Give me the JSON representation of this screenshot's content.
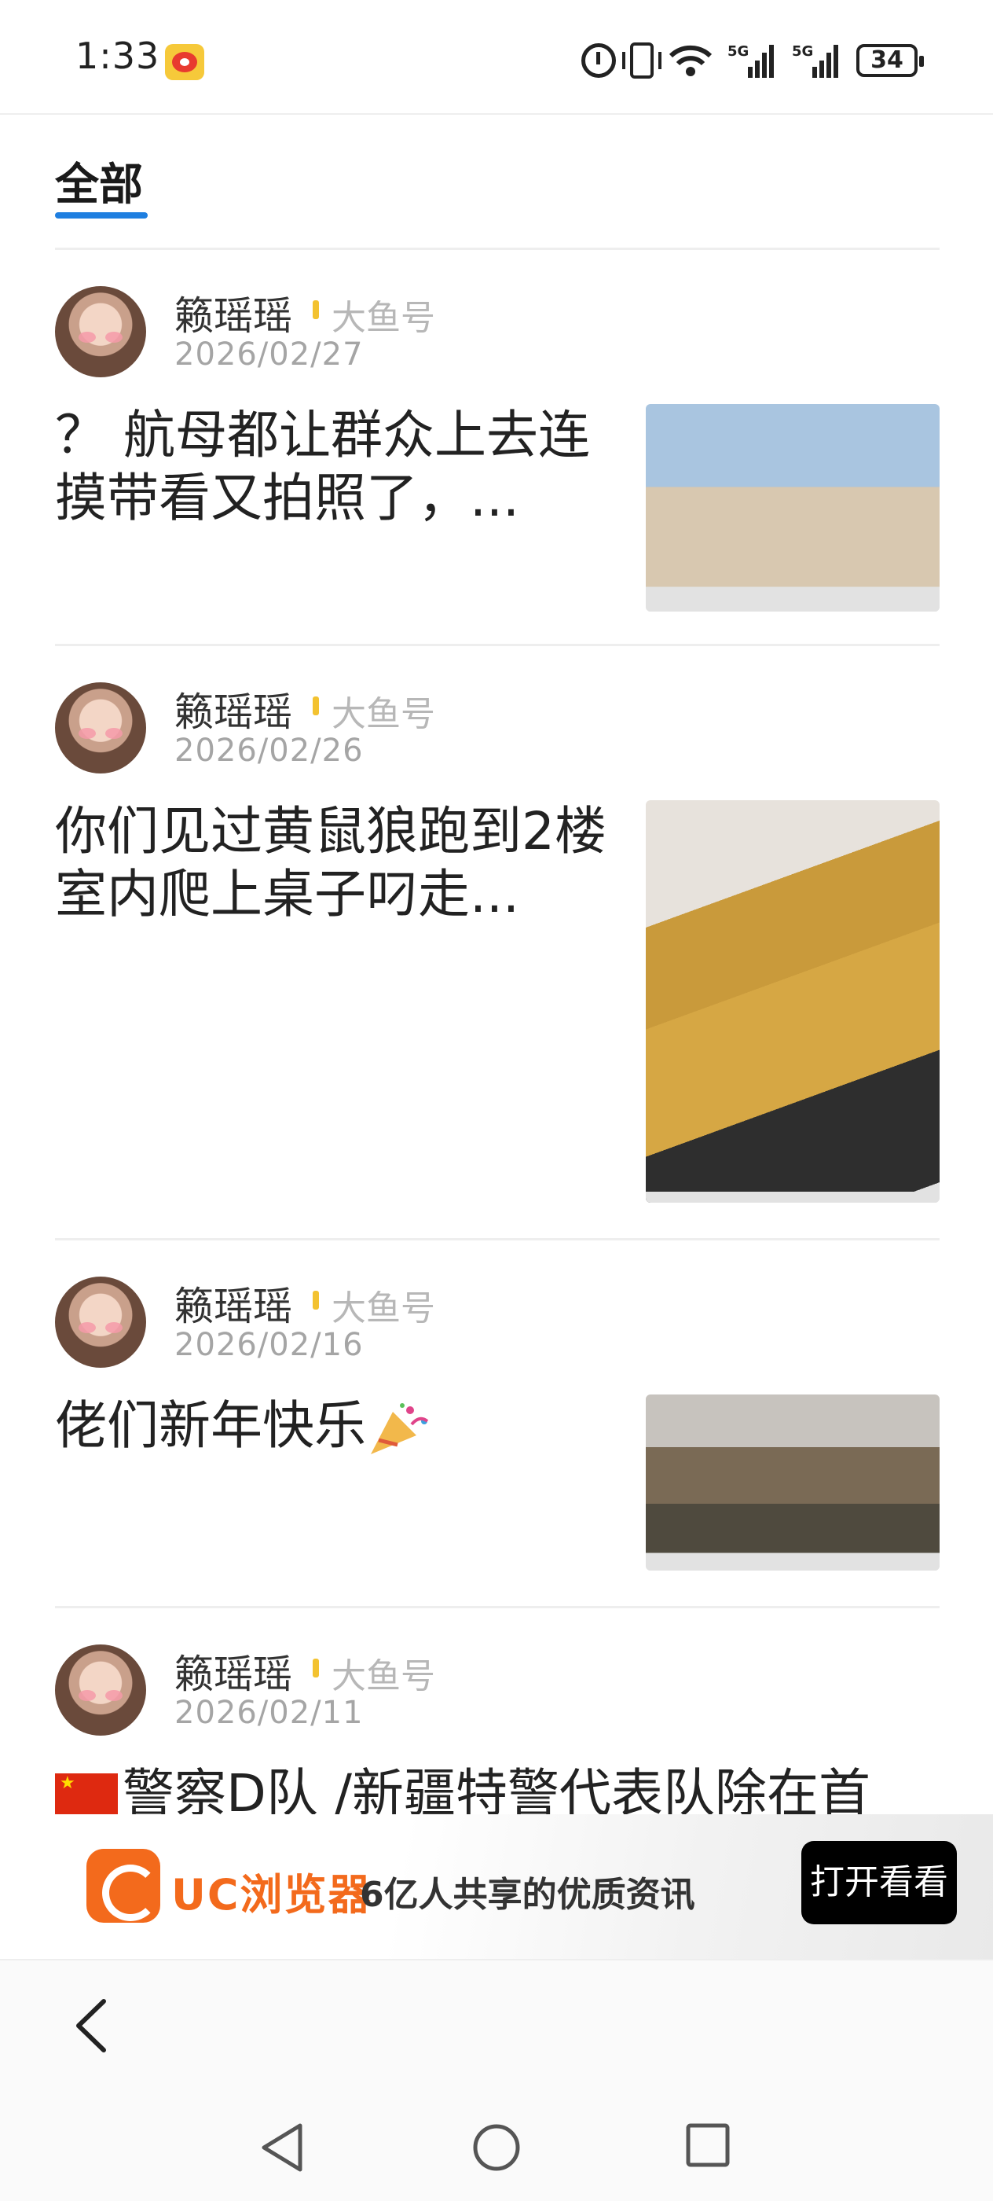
{
  "status_bar": {
    "time": "1:33",
    "battery": "34",
    "network_1": "5G",
    "network_2": "5G",
    "icons": [
      "weibo-icon",
      "alarm-icon",
      "vibrate-icon",
      "wifi-icon",
      "signal-icon",
      "signal-icon",
      "battery-icon"
    ]
  },
  "tabs": [
    {
      "label": "全部",
      "active": true
    }
  ],
  "posts": [
    {
      "author": "籁瑶瑶",
      "source": "大鱼号",
      "date": "2026/02/27",
      "title": "？ 航母都让群众上去连摸带看又拍照了，..."
    },
    {
      "author": "籁瑶瑶",
      "source": "大鱼号",
      "date": "2026/02/26",
      "title": "你们见过黄鼠狼跑到2楼室内爬上桌子叼走..."
    },
    {
      "author": "籁瑶瑶",
      "source": "大鱼号",
      "date": "2026/02/16",
      "title": "佬们新年快乐"
    },
    {
      "author": "籁瑶瑶",
      "source": "大鱼号",
      "date": "2026/02/11",
      "title": "警察D队 /新疆特警代表队除在首"
    }
  ],
  "banner": {
    "brand": "UC浏览器",
    "slogan": "6亿人共享的优质资讯",
    "button": "打开看看",
    "accent": "#f36a1c"
  },
  "colors": {
    "tab_underline": "#1f7fe0",
    "source_mark": "#f3c230"
  }
}
